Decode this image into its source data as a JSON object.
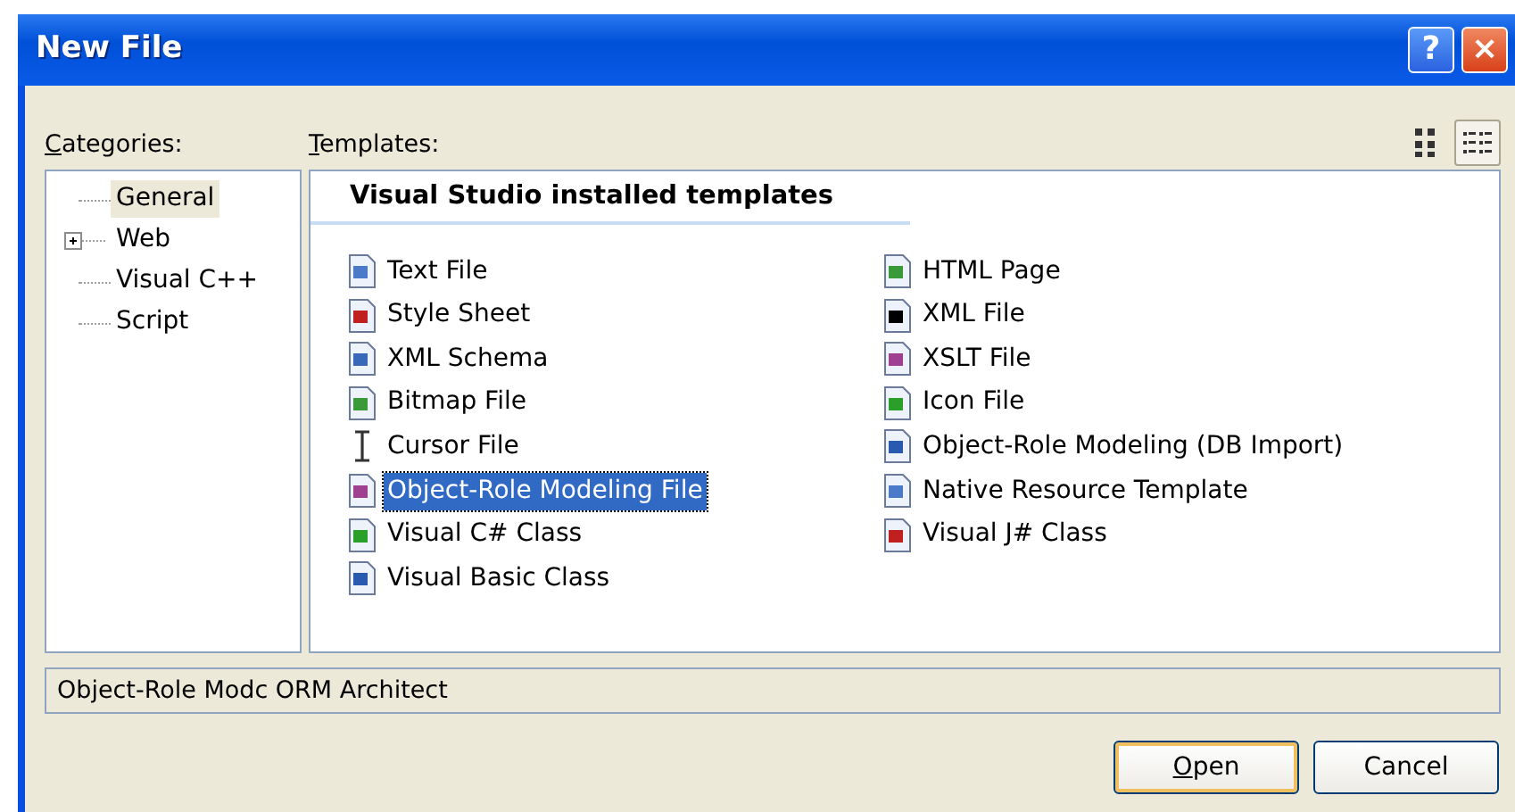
{
  "window": {
    "title": "New File",
    "help_button": "?",
    "close_button": "×"
  },
  "categories": {
    "label": "Categories:",
    "items": [
      {
        "label": "General",
        "selected": true,
        "expandable": false
      },
      {
        "label": "Web",
        "selected": false,
        "expandable": true
      },
      {
        "label": "Visual C++",
        "selected": false,
        "expandable": false
      },
      {
        "label": "Script",
        "selected": false,
        "expandable": false
      }
    ]
  },
  "templates": {
    "label": "Templates:",
    "view_modes": [
      {
        "kind": "large",
        "selected": false
      },
      {
        "kind": "small",
        "selected": true
      }
    ],
    "group_title": "Visual Studio installed templates",
    "columns": [
      [
        {
          "label": "Text File",
          "kind": "document",
          "selected": false
        },
        {
          "label": "Style Sheet",
          "kind": "document",
          "selected": false
        },
        {
          "label": "XML Schema",
          "kind": "document",
          "selected": false
        },
        {
          "label": "Bitmap File",
          "kind": "document",
          "selected": false
        },
        {
          "label": "Cursor File",
          "kind": "cursor",
          "selected": false
        },
        {
          "label": "Object-Role Modeling File",
          "kind": "document",
          "selected": true
        },
        {
          "label": "Visual C# Class",
          "kind": "document",
          "selected": false
        },
        {
          "label": "Visual Basic Class",
          "kind": "document",
          "selected": false
        }
      ],
      [
        {
          "label": "HTML Page",
          "kind": "document",
          "selected": false
        },
        {
          "label": "XML File",
          "kind": "document",
          "selected": false
        },
        {
          "label": "XSLT File",
          "kind": "document",
          "selected": false
        },
        {
          "label": "Icon File",
          "kind": "document",
          "selected": false
        },
        {
          "label": "Object-Role Modeling (DB Import)",
          "kind": "document",
          "selected": false
        },
        {
          "label": "Native Resource Template",
          "kind": "document",
          "selected": false
        },
        {
          "label": "Visual J# Class",
          "kind": "document",
          "selected": false
        }
      ]
    ]
  },
  "description": "Object-Role Modc ORM Architect",
  "buttons": [
    {
      "label": "Open",
      "default": true
    },
    {
      "label": "Cancel",
      "default": false
    }
  ]
}
